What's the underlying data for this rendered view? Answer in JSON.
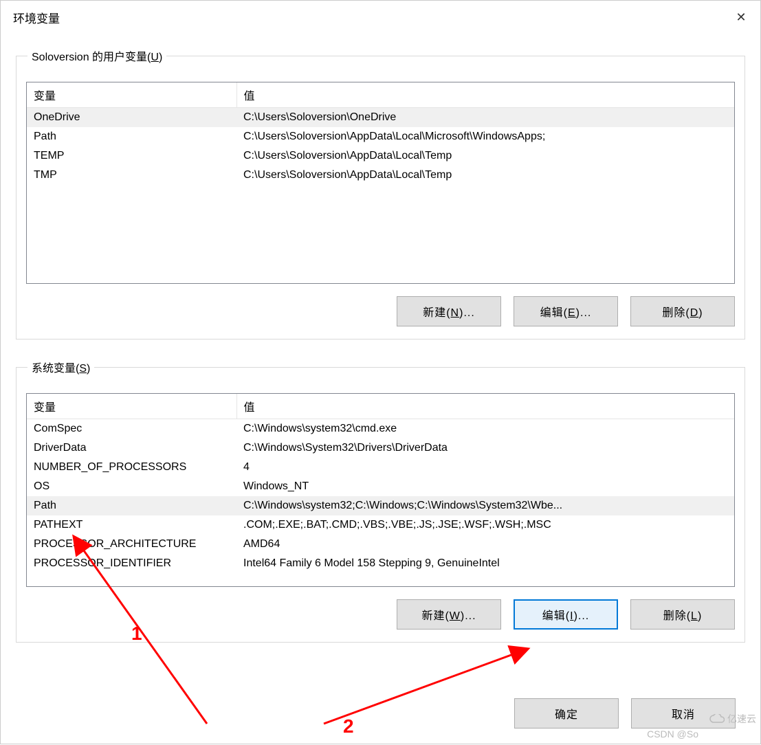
{
  "window": {
    "title": "环境变量",
    "close": "✕"
  },
  "userGroup": {
    "legend_prefix": "Soloversion 的用户变量(",
    "legend_hotkey": "U",
    "legend_suffix": ")",
    "headers": {
      "var": "变量",
      "val": "值"
    },
    "rows": [
      {
        "var": "OneDrive",
        "val": "C:\\Users\\Soloversion\\OneDrive",
        "selected": true
      },
      {
        "var": "Path",
        "val": "C:\\Users\\Soloversion\\AppData\\Local\\Microsoft\\WindowsApps;"
      },
      {
        "var": "TEMP",
        "val": "C:\\Users\\Soloversion\\AppData\\Local\\Temp"
      },
      {
        "var": "TMP",
        "val": "C:\\Users\\Soloversion\\AppData\\Local\\Temp"
      }
    ],
    "buttons": {
      "new": "新建(N)...",
      "edit": "编辑(E)...",
      "delete": "删除(D)"
    }
  },
  "sysGroup": {
    "legend_prefix": "系统变量(",
    "legend_hotkey": "S",
    "legend_suffix": ")",
    "headers": {
      "var": "变量",
      "val": "值"
    },
    "rows": [
      {
        "var": "ComSpec",
        "val": "C:\\Windows\\system32\\cmd.exe"
      },
      {
        "var": "DriverData",
        "val": "C:\\Windows\\System32\\Drivers\\DriverData"
      },
      {
        "var": "NUMBER_OF_PROCESSORS",
        "val": "4"
      },
      {
        "var": "OS",
        "val": "Windows_NT"
      },
      {
        "var": "Path",
        "val": "C:\\Windows\\system32;C:\\Windows;C:\\Windows\\System32\\Wbe...",
        "selected": true
      },
      {
        "var": "PATHEXT",
        "val": ".COM;.EXE;.BAT;.CMD;.VBS;.VBE;.JS;.JSE;.WSF;.WSH;.MSC"
      },
      {
        "var": "PROCESSOR_ARCHITECTURE",
        "val": "AMD64"
      },
      {
        "var": "PROCESSOR_IDENTIFIER",
        "val": "Intel64 Family 6 Model 158 Stepping 9, GenuineIntel"
      }
    ],
    "buttons": {
      "new": "新建(W)...",
      "edit": "编辑(I)...",
      "delete": "删除(L)"
    }
  },
  "dialogButtons": {
    "ok": "确定",
    "cancel": "取消"
  },
  "annotations": {
    "label1": "1",
    "label2": "2"
  },
  "watermark": {
    "csdn": "CSDN @So",
    "yisu": "亿速云"
  }
}
